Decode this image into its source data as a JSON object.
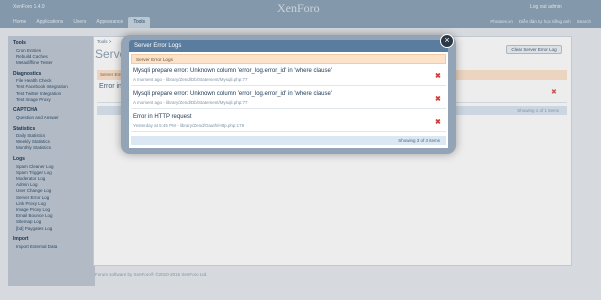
{
  "app": {
    "title": "XenForo 1.4.9",
    "logo": "XenForo",
    "logout": "Log out admin"
  },
  "tabs": [
    {
      "label": "Home"
    },
    {
      "label": "Applications"
    },
    {
      "label": "Users"
    },
    {
      "label": "Appearance"
    },
    {
      "label": "Tools"
    }
  ],
  "top_right": {
    "site": "Phrases.vn",
    "site2": "Diễn đàn tự học tiếng anh",
    "search": "Search"
  },
  "sidebar": {
    "groups": [
      {
        "title": "Tools",
        "items": [
          "Cron Entries",
          "Rebuild Caches",
          "Metadiff/ine Tester"
        ]
      },
      {
        "title": "Diagnostics",
        "items": [
          "File Health Check",
          "Test Facebook Integration",
          "Test Twitter Integration",
          "Test Image Proxy"
        ]
      },
      {
        "title": "CAPTCHA",
        "items": [
          "Question and Answer"
        ]
      },
      {
        "title": "Statistics",
        "items": [
          "Daily Statistics",
          "Weekly Statistics",
          "Monthly Statistics"
        ]
      },
      {
        "title": "Logs",
        "items": [
          "Spam Cleaner Log",
          "Spam Trigger Log",
          "Moderator Log",
          "Admin Log",
          "User Change Log",
          "Server Error Log",
          "Link Proxy Log",
          "Image Proxy Log",
          "Email Bounce Log",
          "Sitemap Log",
          "[bd] Paygates Log"
        ]
      },
      {
        "title": "Import",
        "items": [
          "Import External Data"
        ]
      }
    ]
  },
  "page": {
    "breadcrumb": "Tools >",
    "title": "Server Error Logs",
    "clear_button": "Clear Server Error Log",
    "bg_header": "Server Error Logs",
    "bg_row": "Error in HTTP request",
    "bg_showing": "Showing 1 of 1 items",
    "footer": "Forum software by XenForo® ©2010-2015 XenForo Ltd."
  },
  "modal": {
    "title": "Server Error Logs",
    "subheader": "Server Error Logs",
    "close_icon": "close-icon",
    "items": [
      {
        "title": "Mysqli prepare error: Unknown column 'error_log.error_id' in 'where clause'",
        "meta": "A moment ago - library/Zend/Db/Statement/Mysqli.php:77"
      },
      {
        "title": "Mysqli prepare error: Unknown column 'error_log.error_id' in 'where clause'",
        "meta": "A moment ago - library/Zend/Db/Statement/Mysqli.php:77"
      },
      {
        "title": "Error in HTTP request",
        "meta": "Yesterday at 5:45 PM - library/Zend/Oauth/Http.php:178"
      }
    ],
    "footer": "Showing 3 of 3 items"
  }
}
